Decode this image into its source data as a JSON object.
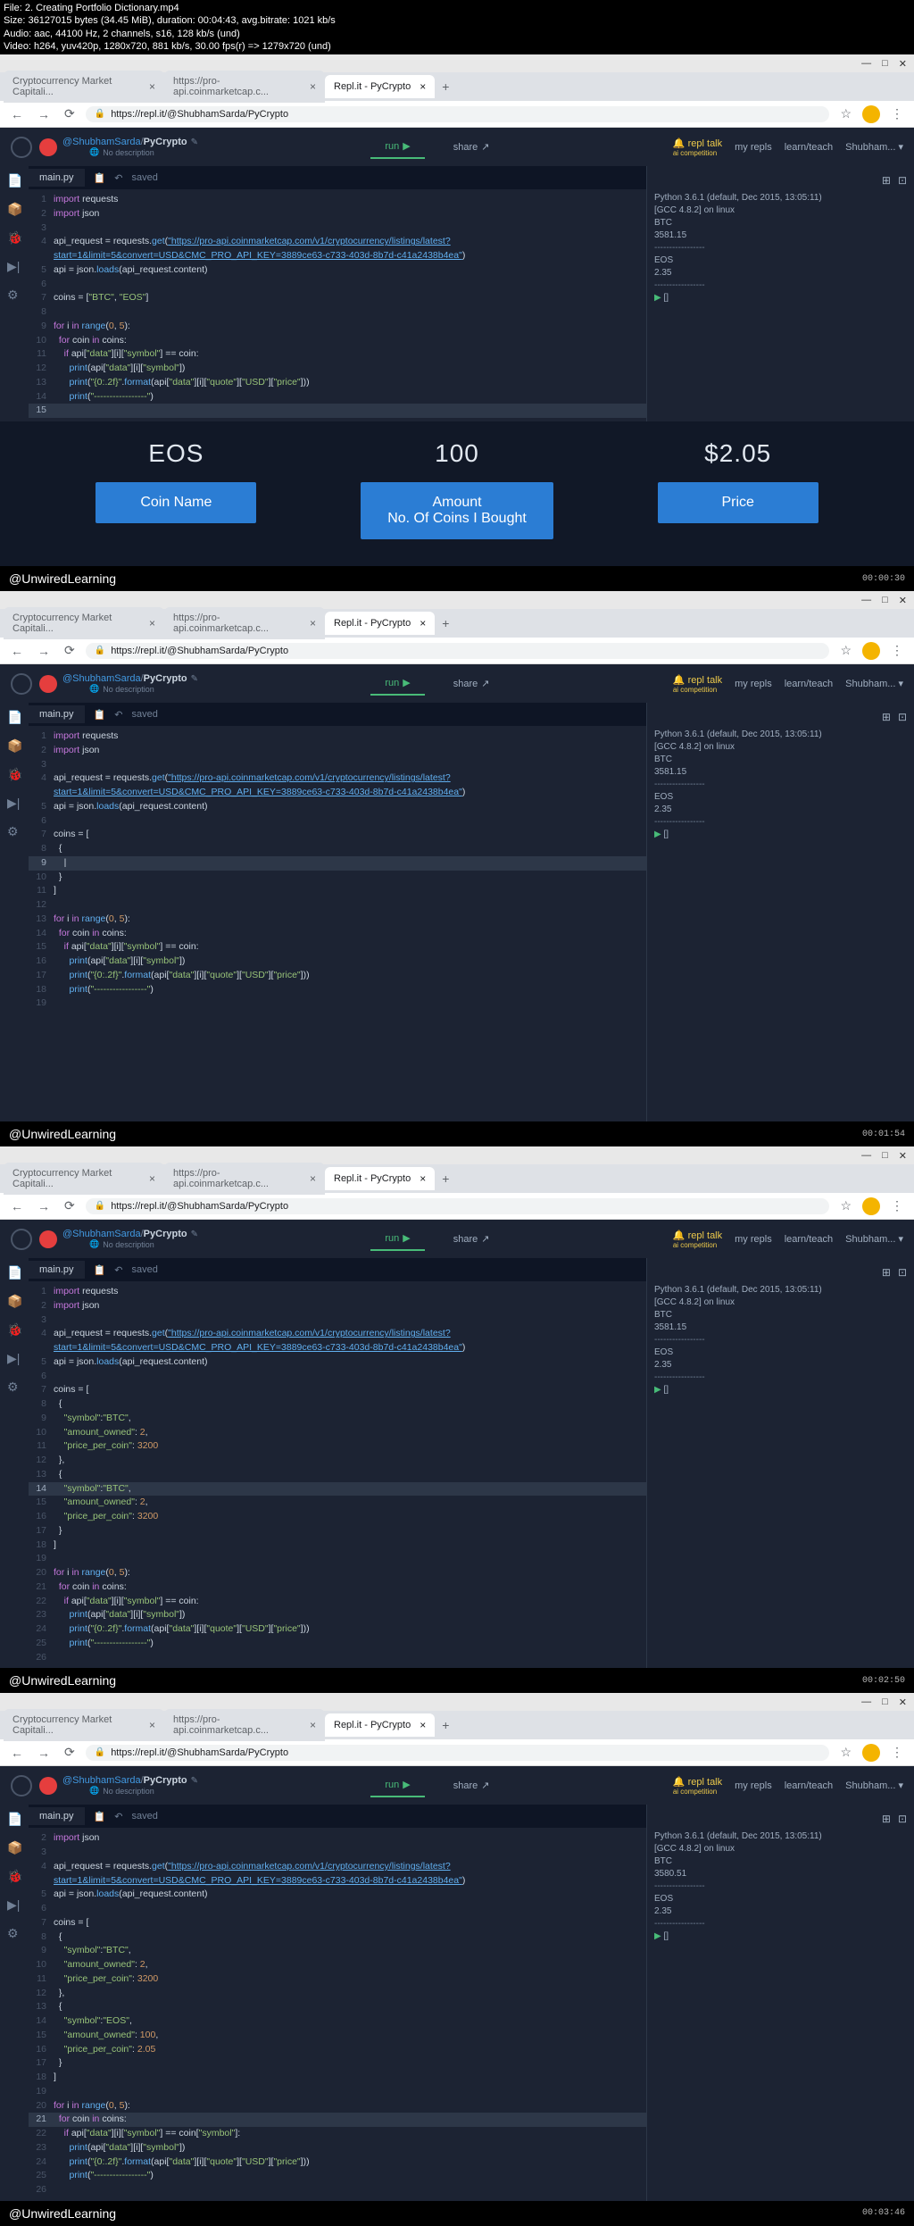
{
  "file_info": {
    "line1": "File: 2. Creating Portfolio Dictionary.mp4",
    "line2": "Size: 36127015 bytes (34.45 MiB), duration: 00:04:43, avg.bitrate: 1021 kb/s",
    "line3": "Audio: aac, 44100 Hz, 2 channels, s16, 128 kb/s (und)",
    "line4": "Video: h264, yuv420p, 1280x720, 881 kb/s, 30.00 fps(r) => 1279x720 (und)"
  },
  "browser": {
    "tabs": [
      {
        "title": "Cryptocurrency Market Capitali..."
      },
      {
        "title": "https://pro-api.coinmarketcap.c..."
      },
      {
        "title": "Repl.it - PyCrypto"
      }
    ],
    "url": "https://repl.it/@ShubhamSarda/PyCrypto",
    "window_min": "—",
    "window_max": "□",
    "window_close": "✕"
  },
  "replit": {
    "user": "@ShubhamSarda",
    "project": "PyCrypto",
    "no_desc": "No description",
    "run": "run",
    "share": "share",
    "nav": {
      "repl_talk": "repl talk",
      "ai_comp": "ai competition",
      "my_repls": "my repls",
      "learn": "learn/teach",
      "username": "Shubham..."
    },
    "editor": {
      "filename": "main.py",
      "saved": "saved"
    }
  },
  "console": {
    "header": "Python 3.6.1 (default, Dec 2015, 13:05:11)",
    "gcc": "[GCC 4.8.2] on linux",
    "btc_label": "BTC",
    "btc_val": "3581.15",
    "eos_label": "EOS",
    "eos_val": "2.35",
    "dashes": "-----------------",
    "prompt_empty": "[]",
    "btc_val2": "3580.51"
  },
  "overlay": {
    "col1": {
      "value": "EOS",
      "label": "Coin Name"
    },
    "col2": {
      "value": "100",
      "label1": "Amount",
      "label2": "No. Of Coins I Bought"
    },
    "col3": {
      "value": "$2.05",
      "label": "Price"
    }
  },
  "footer": {
    "brand": "@UnwiredLearning",
    "ts1": "00:00:30",
    "ts2": "00:01:54",
    "ts3": "00:02:50",
    "ts4": "00:03:46"
  },
  "code_frames": {
    "frame1": {
      "lines": [
        {
          "n": "1",
          "c": "<span class='kw'>import</span> requests"
        },
        {
          "n": "2",
          "c": "<span class='kw'>import</span> json"
        },
        {
          "n": "3",
          "c": ""
        },
        {
          "n": "4",
          "c": "api_request = requests.<span class='fn'>get</span>(<span class='url-str'>\"https://pro-api.coinmarketcap.com/v1/cryptocurrency/listings/latest?</span>"
        },
        {
          "n": "",
          "c": "<span class='url-str'>start=1&limit=5&convert=USD&CMC_PRO_API_KEY=3889ce63-c733-403d-8b7d-c41a2438b4ea\"</span>)"
        },
        {
          "n": "5",
          "c": "api = json.<span class='fn'>loads</span>(api_request.content)"
        },
        {
          "n": "6",
          "c": ""
        },
        {
          "n": "7",
          "c": "coins = [<span class='str'>\"BTC\"</span>, <span class='str'>\"EOS\"</span>]"
        },
        {
          "n": "8",
          "c": ""
        },
        {
          "n": "9",
          "c": "<span class='kw'>for</span> i <span class='kw'>in</span> <span class='fn'>range</span>(<span class='num'>0</span>, <span class='num'>5</span>):"
        },
        {
          "n": "10",
          "c": "  <span class='kw'>for</span> coin <span class='kw'>in</span> coins:"
        },
        {
          "n": "11",
          "c": "    <span class='kw'>if</span> api[<span class='str'>\"data\"</span>][i][<span class='str'>\"symbol\"</span>] == coin:"
        },
        {
          "n": "12",
          "c": "      <span class='fn'>print</span>(api[<span class='str'>\"data\"</span>][i][<span class='str'>\"symbol\"</span>])"
        },
        {
          "n": "13",
          "c": "      <span class='fn'>print</span>(<span class='str'>\"{0:.2f}\"</span>.<span class='fn'>format</span>(api[<span class='str'>\"data\"</span>][i][<span class='str'>\"quote\"</span>][<span class='str'>\"USD\"</span>][<span class='str'>\"price\"</span>]))"
        },
        {
          "n": "14",
          "c": "      <span class='fn'>print</span>(<span class='str'>\"-----------------\"</span>)"
        },
        {
          "n": "15",
          "c": "",
          "hl": true
        }
      ]
    },
    "frame2": {
      "lines": [
        {
          "n": "1",
          "c": "<span class='kw'>import</span> requests"
        },
        {
          "n": "2",
          "c": "<span class='kw'>import</span> json"
        },
        {
          "n": "3",
          "c": ""
        },
        {
          "n": "4",
          "c": "api_request = requests.<span class='fn'>get</span>(<span class='url-str'>\"https://pro-api.coinmarketcap.com/v1/cryptocurrency/listings/latest?</span>"
        },
        {
          "n": "",
          "c": "<span class='url-str'>start=1&limit=5&convert=USD&CMC_PRO_API_KEY=3889ce63-c733-403d-8b7d-c41a2438b4ea\"</span>)"
        },
        {
          "n": "5",
          "c": "api = json.<span class='fn'>loads</span>(api_request.content)"
        },
        {
          "n": "6",
          "c": ""
        },
        {
          "n": "7",
          "c": "coins = ["
        },
        {
          "n": "8",
          "c": "  {"
        },
        {
          "n": "9",
          "c": "    |",
          "hl": true
        },
        {
          "n": "10",
          "c": "  }"
        },
        {
          "n": "11",
          "c": "]"
        },
        {
          "n": "12",
          "c": ""
        },
        {
          "n": "13",
          "c": "<span class='kw'>for</span> i <span class='kw'>in</span> <span class='fn'>range</span>(<span class='num'>0</span>, <span class='num'>5</span>):"
        },
        {
          "n": "14",
          "c": "  <span class='kw'>for</span> coin <span class='kw'>in</span> coins:"
        },
        {
          "n": "15",
          "c": "    <span class='kw'>if</span> api[<span class='str'>\"data\"</span>][i][<span class='str'>\"symbol\"</span>] == coin:"
        },
        {
          "n": "16",
          "c": "      <span class='fn'>print</span>(api[<span class='str'>\"data\"</span>][i][<span class='str'>\"symbol\"</span>])"
        },
        {
          "n": "17",
          "c": "      <span class='fn'>print</span>(<span class='str'>\"{0:.2f}\"</span>.<span class='fn'>format</span>(api[<span class='str'>\"data\"</span>][i][<span class='str'>\"quote\"</span>][<span class='str'>\"USD\"</span>][<span class='str'>\"price\"</span>]))"
        },
        {
          "n": "18",
          "c": "      <span class='fn'>print</span>(<span class='str'>\"-----------------\"</span>)"
        },
        {
          "n": "19",
          "c": ""
        }
      ]
    },
    "frame3": {
      "lines": [
        {
          "n": "1",
          "c": "<span class='kw'>import</span> requests"
        },
        {
          "n": "2",
          "c": "<span class='kw'>import</span> json"
        },
        {
          "n": "3",
          "c": ""
        },
        {
          "n": "4",
          "c": "api_request = requests.<span class='fn'>get</span>(<span class='url-str'>\"https://pro-api.coinmarketcap.com/v1/cryptocurrency/listings/latest?</span>"
        },
        {
          "n": "",
          "c": "<span class='url-str'>start=1&limit=5&convert=USD&CMC_PRO_API_KEY=3889ce63-c733-403d-8b7d-c41a2438b4ea\"</span>)"
        },
        {
          "n": "5",
          "c": "api = json.<span class='fn'>loads</span>(api_request.content)"
        },
        {
          "n": "6",
          "c": ""
        },
        {
          "n": "7",
          "c": "coins = ["
        },
        {
          "n": "8",
          "c": "  {"
        },
        {
          "n": "9",
          "c": "    <span class='str'>\"symbol\"</span>:<span class='str'>\"BTC\"</span>,"
        },
        {
          "n": "10",
          "c": "    <span class='str'>\"amount_owned\"</span>: <span class='num'>2</span>,"
        },
        {
          "n": "11",
          "c": "    <span class='str'>\"price_per_coin\"</span>: <span class='num'>3200</span>"
        },
        {
          "n": "12",
          "c": "  },"
        },
        {
          "n": "13",
          "c": "  {"
        },
        {
          "n": "14",
          "c": "    <span class='str'>\"symbol\"</span>:<span class='str'>\"BTC\"</span>,",
          "hl": true
        },
        {
          "n": "15",
          "c": "    <span class='str'>\"amount_owned\"</span>: <span class='num'>2</span>,"
        },
        {
          "n": "16",
          "c": "    <span class='str'>\"price_per_coin\"</span>: <span class='num'>3200</span>"
        },
        {
          "n": "17",
          "c": "  }"
        },
        {
          "n": "18",
          "c": "]"
        },
        {
          "n": "19",
          "c": ""
        },
        {
          "n": "20",
          "c": "<span class='kw'>for</span> i <span class='kw'>in</span> <span class='fn'>range</span>(<span class='num'>0</span>, <span class='num'>5</span>):"
        },
        {
          "n": "21",
          "c": "  <span class='kw'>for</span> coin <span class='kw'>in</span> coins:"
        },
        {
          "n": "22",
          "c": "    <span class='kw'>if</span> api[<span class='str'>\"data\"</span>][i][<span class='str'>\"symbol\"</span>] == coin:"
        },
        {
          "n": "23",
          "c": "      <span class='fn'>print</span>(api[<span class='str'>\"data\"</span>][i][<span class='str'>\"symbol\"</span>])"
        },
        {
          "n": "24",
          "c": "      <span class='fn'>print</span>(<span class='str'>\"{0:.2f}\"</span>.<span class='fn'>format</span>(api[<span class='str'>\"data\"</span>][i][<span class='str'>\"quote\"</span>][<span class='str'>\"USD\"</span>][<span class='str'>\"price\"</span>]))"
        },
        {
          "n": "25",
          "c": "      <span class='fn'>print</span>(<span class='str'>\"-----------------\"</span>)"
        },
        {
          "n": "26",
          "c": ""
        }
      ]
    },
    "frame4": {
      "lines": [
        {
          "n": "2",
          "c": "<span class='kw'>import</span> json"
        },
        {
          "n": "3",
          "c": ""
        },
        {
          "n": "4",
          "c": "api_request = requests.<span class='fn'>get</span>(<span class='url-str'>\"https://pro-api.coinmarketcap.com/v1/cryptocurrency/listings/latest?</span>"
        },
        {
          "n": "",
          "c": "<span class='url-str'>start=1&limit=5&convert=USD&CMC_PRO_API_KEY=3889ce63-c733-403d-8b7d-c41a2438b4ea\"</span>)"
        },
        {
          "n": "5",
          "c": "api = json.<span class='fn'>loads</span>(api_request.content)"
        },
        {
          "n": "6",
          "c": ""
        },
        {
          "n": "7",
          "c": "coins = ["
        },
        {
          "n": "8",
          "c": "  {"
        },
        {
          "n": "9",
          "c": "    <span class='str'>\"symbol\"</span>:<span class='str'>\"BTC\"</span>,"
        },
        {
          "n": "10",
          "c": "    <span class='str'>\"amount_owned\"</span>: <span class='num'>2</span>,"
        },
        {
          "n": "11",
          "c": "    <span class='str'>\"price_per_coin\"</span>: <span class='num'>3200</span>"
        },
        {
          "n": "12",
          "c": "  },"
        },
        {
          "n": "13",
          "c": "  {"
        },
        {
          "n": "14",
          "c": "    <span class='str'>\"symbol\"</span>:<span class='str'>\"EOS\"</span>,"
        },
        {
          "n": "15",
          "c": "    <span class='str'>\"amount_owned\"</span>: <span class='num'>100</span>,"
        },
        {
          "n": "16",
          "c": "    <span class='str'>\"price_per_coin\"</span>: <span class='num'>2.05</span>"
        },
        {
          "n": "17",
          "c": "  }"
        },
        {
          "n": "18",
          "c": "]"
        },
        {
          "n": "19",
          "c": ""
        },
        {
          "n": "20",
          "c": "<span class='kw'>for</span> i <span class='kw'>in</span> <span class='fn'>range</span>(<span class='num'>0</span>, <span class='num'>5</span>):"
        },
        {
          "n": "21",
          "c": "  <span class='kw'>for</span> coin <span class='kw'>in</span> coins:",
          "hl": true
        },
        {
          "n": "22",
          "c": "    <span class='kw'>if</span> api[<span class='str'>\"data\"</span>][i][<span class='str'>\"symbol\"</span>] == coin[<span class='str'>\"symbol\"</span>]:"
        },
        {
          "n": "23",
          "c": "      <span class='fn'>print</span>(api[<span class='str'>\"data\"</span>][i][<span class='str'>\"symbol\"</span>])"
        },
        {
          "n": "24",
          "c": "      <span class='fn'>print</span>(<span class='str'>\"{0:.2f}\"</span>.<span class='fn'>format</span>(api[<span class='str'>\"data\"</span>][i][<span class='str'>\"quote\"</span>][<span class='str'>\"USD\"</span>][<span class='str'>\"price\"</span>]))"
        },
        {
          "n": "25",
          "c": "      <span class='fn'>print</span>(<span class='str'>\"-----------------\"</span>)"
        },
        {
          "n": "26",
          "c": ""
        }
      ]
    }
  }
}
